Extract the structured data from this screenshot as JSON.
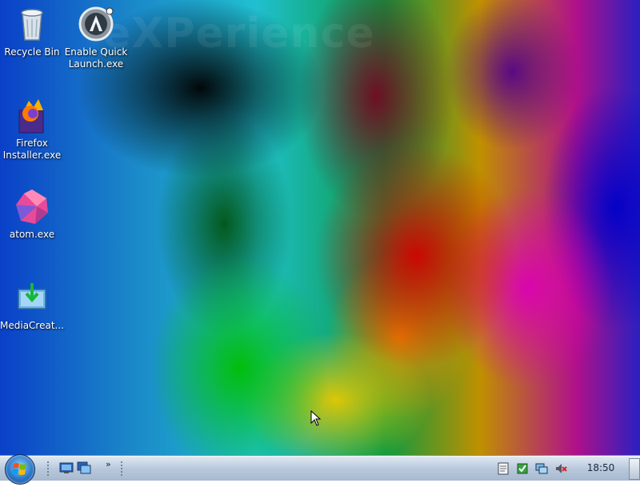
{
  "desktop": {
    "watermark": "eXPerience",
    "icons": [
      {
        "label": "Recycle Bin",
        "icon": "recycle-bin-icon"
      },
      {
        "label": "Enable Quick Launch.exe",
        "icon": "quick-launch-app-icon"
      },
      {
        "label": "Firefox Installer.exe",
        "icon": "firefox-installer-icon"
      },
      {
        "label": "atom.exe",
        "icon": "atom-icon"
      },
      {
        "label": "MediaCreat...",
        "icon": "media-creation-tool-icon"
      }
    ]
  },
  "taskbar": {
    "start_icon": "windows-logo-icon",
    "quick_launch": [
      "show-desktop-icon",
      "switch-windows-icon"
    ],
    "overflow_chevron": "»",
    "tray_icons": [
      "notes-icon",
      "security-icon",
      "network-icon",
      "volume-muted-icon"
    ],
    "clock": "18:50"
  }
}
